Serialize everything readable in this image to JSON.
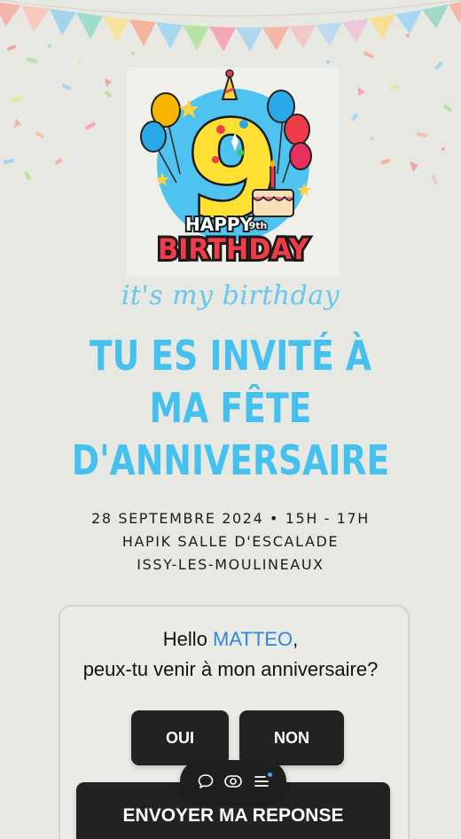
{
  "invitation": {
    "tagline": "it's my birthday",
    "headline": [
      "TU ES INVITÉ À",
      "MA FÊTE",
      "D'ANNIVERSAIRE"
    ],
    "details": [
      "28 SEPTEMBRE 2024  •  15H - 17H",
      "HAPIK SALLE D'ESCALADE",
      "ISSY-LES-MOULINEAUX"
    ],
    "poster_text": {
      "number": "9",
      "happy": "HAPPY",
      "ordinal": "9th",
      "birthday": "BIRTHDAY"
    }
  },
  "rsvp": {
    "greeting_prefix": "Hello ",
    "guest_name": "MATTEO",
    "greeting_suffix": ",",
    "question": "peux-tu venir à mon anniversaire?",
    "yes_label": "OUI",
    "no_label": "NON",
    "send_label": "ENVOYER MA REPONSE"
  },
  "toolbar": {
    "icons": [
      "comment-icon",
      "preview-eye-icon",
      "menu-icon"
    ]
  },
  "colors": {
    "background": "#e8e8e3",
    "headline": "#45c1ef",
    "tagline": "#66c8ee",
    "name": "#2e86de",
    "button": "#222222",
    "notification_dot": "#4aa3ff"
  }
}
